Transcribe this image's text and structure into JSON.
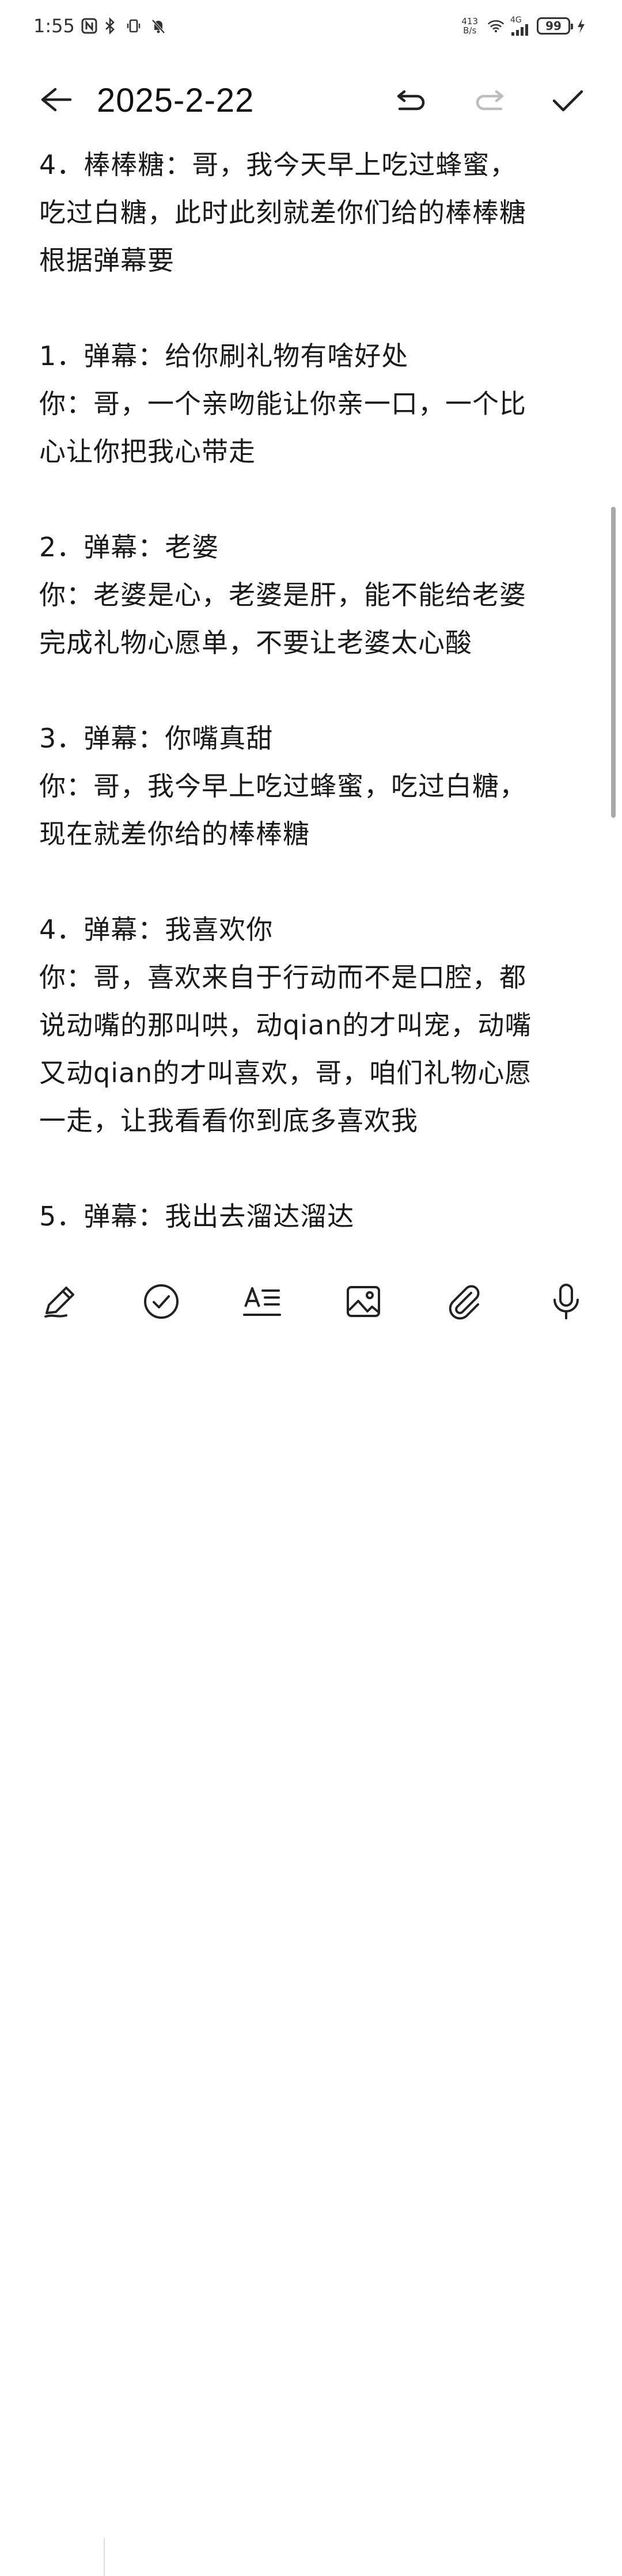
{
  "status_bar": {
    "time": "1:55",
    "net_speed_value": "413",
    "net_speed_unit": "B/s",
    "network_type": "4G",
    "battery": "99",
    "icons": [
      "nfc-icon",
      "bluetooth-icon",
      "vibrate-icon",
      "mute-icon",
      "wifi-icon",
      "signal-icon",
      "battery-icon",
      "charging-icon"
    ]
  },
  "toolbar": {
    "title": "2025-2-22",
    "icons": [
      "back-arrow-icon",
      "undo-icon",
      "redo-icon",
      "checkmark-icon"
    ]
  },
  "note": {
    "lines": [
      "4．棒棒糖：哥，我今天早上吃过蜂蜜，",
      "吃过白糖，此时此刻就差你们给的棒棒糖",
      "根据弹幕要",
      "",
      "1．弹幕：给你刷礼物有啥好处",
      "你：哥，一个亲吻能让你亲一口，一个比",
      "心让你把我心带走",
      "",
      "2．弹幕：老婆",
      "你：老婆是心，老婆是肝，能不能给老婆",
      "完成礼物心愿单，不要让老婆太心酸",
      "",
      "3．弹幕：你嘴真甜",
      "你：哥，我今早上吃过蜂蜜，吃过白糖，",
      "现在就差你给的棒棒糖",
      "",
      "4．弹幕：我喜欢你",
      "你：哥，喜欢来自于行动而不是口腔，都",
      "说动嘴的那叫哄，动qian的才叫宠，动嘴",
      "又动qian的才叫喜欢，哥，咱们礼物心愿",
      "一走，让我看看你到底多喜欢我",
      "",
      "5．弹幕：我出去溜达溜达"
    ]
  },
  "bottom_bar": {
    "icons": [
      "pen-icon",
      "checklist-icon",
      "text-format-icon",
      "image-icon",
      "attachment-icon",
      "microphone-icon"
    ]
  }
}
